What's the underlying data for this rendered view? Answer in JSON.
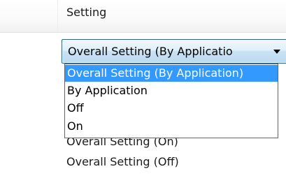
{
  "header": {
    "column_label": "Setting"
  },
  "combo": {
    "selected_value": "Overall Setting (By Applicatio",
    "arrow_icon": "triangle-down-icon"
  },
  "dropdown": {
    "options": [
      {
        "label": "Overall Setting (By Application)",
        "selected": true
      },
      {
        "label": "By Application",
        "selected": false
      },
      {
        "label": "Off",
        "selected": false
      },
      {
        "label": "On",
        "selected": false
      }
    ],
    "highlight_color": "#3399ff"
  },
  "list": {
    "items": [
      {
        "label": "Overall Setting (On)"
      },
      {
        "label": "Overall Setting (Off)"
      }
    ]
  }
}
